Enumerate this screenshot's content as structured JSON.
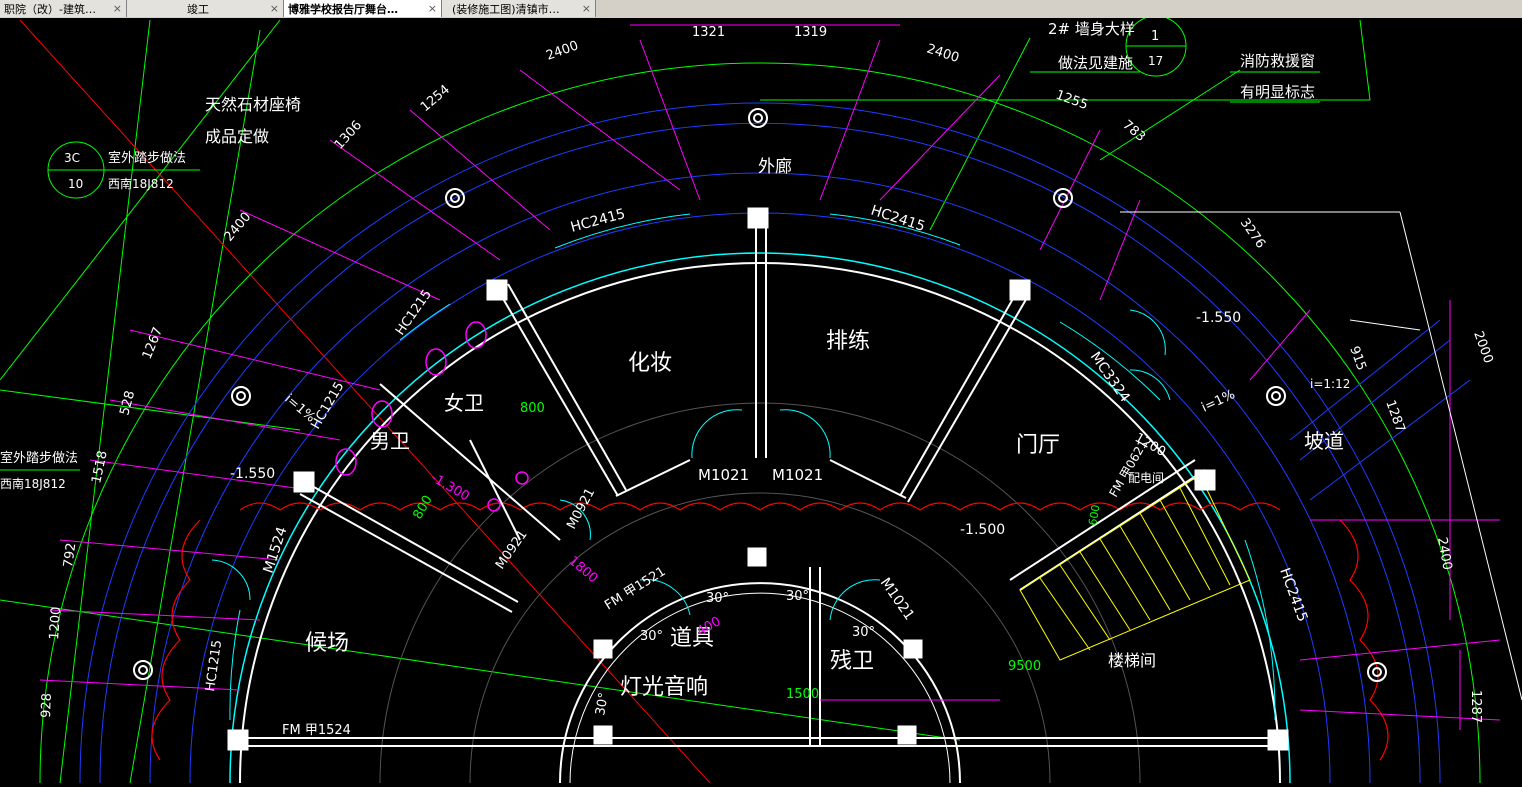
{
  "tabs": [
    {
      "label": "职院（改）-建筑…",
      "active": false
    },
    {
      "label": "竣工",
      "active": false
    },
    {
      "label": "博雅学校报告厅舞台…",
      "active": true
    },
    {
      "label": "(装修施工图)清镇市…",
      "active": false
    }
  ],
  "close_glyph": "×",
  "rooms": {
    "outer_corridor": "外廊",
    "makeup": "化妆",
    "rehearsal": "排练",
    "lobby": "门厅",
    "ramp": "坡道",
    "womens_wc": "女卫",
    "mens_wc": "男卫",
    "waiting": "候场",
    "props": "道具",
    "lighting_sound": "灯光音响",
    "accessible_wc": "残卫",
    "stair": "楼梯间",
    "distribution": "配电间"
  },
  "notes": {
    "stone_seat_1": "天然石材座椅",
    "stone_seat_2": "成品定做",
    "wall_detail_1": "2# 墙身大样",
    "wall_detail_2": "做法见建施",
    "fire_window_1": "消防救援窗",
    "fire_window_2": "有明显标志",
    "step_1": "室外踏步做法",
    "step_2": "西南18J812",
    "step_left_1": "室外踏步做法",
    "step_left_2": "西南18J812"
  },
  "callouts": {
    "detail_top_num": "3C",
    "detail_bottom_num": "10",
    "wall_top_num": "1",
    "wall_bottom_num": "17"
  },
  "doors": {
    "m1021_a": "M1021",
    "m1021_b": "M1021",
    "m1021_c": "M1021",
    "mc3324": "MC3324",
    "m1524": "M1524",
    "m0921_a": "M0921",
    "m0921_b": "M0921",
    "fm1521": "FM 甲1521",
    "fm1524": "FM 甲1524",
    "fm_side": "FM 甲0621",
    "hc2415_a": "HC2415",
    "hc2415_b": "HC2415",
    "hc2415_c": "HC2415",
    "hc1215_a": "HC1215",
    "hc1215_b": "HC1215",
    "hc1215_c": "HC1215"
  },
  "levels": {
    "l1": "-1.550",
    "l2": "-1.550",
    "l3": "-1.500",
    "l4": "-1.300"
  },
  "dims": {
    "d1321": "1321",
    "d1319": "1319",
    "d2400_a": "2400",
    "d2400_b": "2400",
    "d2400_c": "2400",
    "d2400_d": "2400",
    "d1254": "1254",
    "d1255": "1255",
    "d1306": "1306",
    "d783": "783",
    "d3276": "3276",
    "d1267": "1267",
    "d528": "528",
    "d1518": "1518",
    "d792": "792",
    "d1200_a": "1200",
    "d1200_b": "1200",
    "d928": "928",
    "d800_a": "800",
    "d800_b": "800",
    "d1800": "1800",
    "d1500": "1500",
    "d9500": "9500",
    "d2000": "2000",
    "d915": "915",
    "d1287_a": "1287",
    "d1287_b": "1287",
    "d600": "600",
    "d400": "400",
    "slope_a": "i=1:12",
    "slope_b": "i=1%",
    "slope_c": "i=1%",
    "ang30_a": "30°",
    "ang30_b": "30°",
    "ang30_c": "30°",
    "ang30_d": "30°",
    "ang30_e": "30°"
  },
  "colors": {
    "background": "#000000",
    "wall": "#ffffff",
    "dimension": "#ff00ff",
    "axis": "#00ff00",
    "outline_blue": "#1e3cff",
    "glazing": "#00ffff",
    "section_red": "#ff0000",
    "stair_yellow": "#ffff00"
  }
}
